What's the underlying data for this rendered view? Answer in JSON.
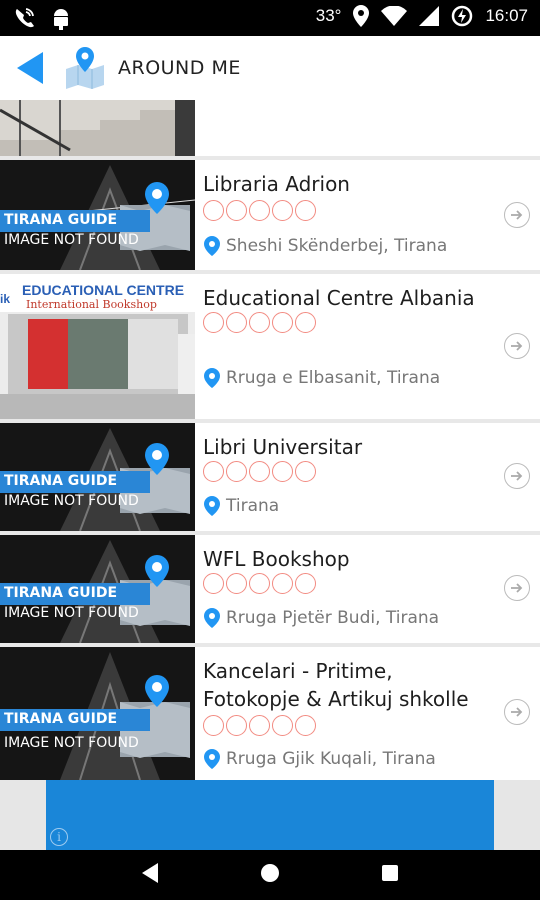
{
  "status_bar": {
    "temperature": "33°",
    "time": "16:07",
    "icons": [
      "phone-wifi-icon",
      "android-icon",
      "location-icon",
      "wifi-icon",
      "signal-icon",
      "battery-saver-icon"
    ]
  },
  "app_bar": {
    "title": "AROUND ME",
    "back_icon": "back-arrow-icon",
    "logo_icon": "map-pin-icon"
  },
  "colors": {
    "accent": "#2196f3",
    "star_outline": "#f28b82",
    "ad_blue": "#1a86d8"
  },
  "placeholder": {
    "line1": "TIRANA GUIDE",
    "line2": "IMAGE NOT FOUND"
  },
  "places": [
    {
      "name": "Libraria Adrion",
      "address": "Sheshi Skënderbej, Tirana",
      "rating": 0,
      "image": "placeholder"
    },
    {
      "name": "Educational Centre Albania",
      "address": "Rruga e Elbasanit, Tirana",
      "rating": 0,
      "image": "shopfront",
      "sign_text": "EDUCATIONAL CENTRE",
      "sign_subtext": "International Bookshop",
      "sign_prefix": "ik"
    },
    {
      "name": "Libri Universitar",
      "address": "Tirana",
      "rating": 0,
      "image": "placeholder"
    },
    {
      "name": "WFL Bookshop",
      "address": "Rruga Pjetër Budi, Tirana",
      "rating": 0,
      "image": "placeholder"
    },
    {
      "name": "Kancelari - Pritime, Fotokopje & Artikuj shkolle",
      "address": "Rruga Gjik Kuqali, Tirana",
      "rating": 0,
      "image": "placeholder"
    }
  ],
  "ad": {
    "info_label": "i"
  },
  "nav_bar": {
    "icons": [
      "back-nav-icon",
      "home-nav-icon",
      "recents-nav-icon"
    ]
  }
}
